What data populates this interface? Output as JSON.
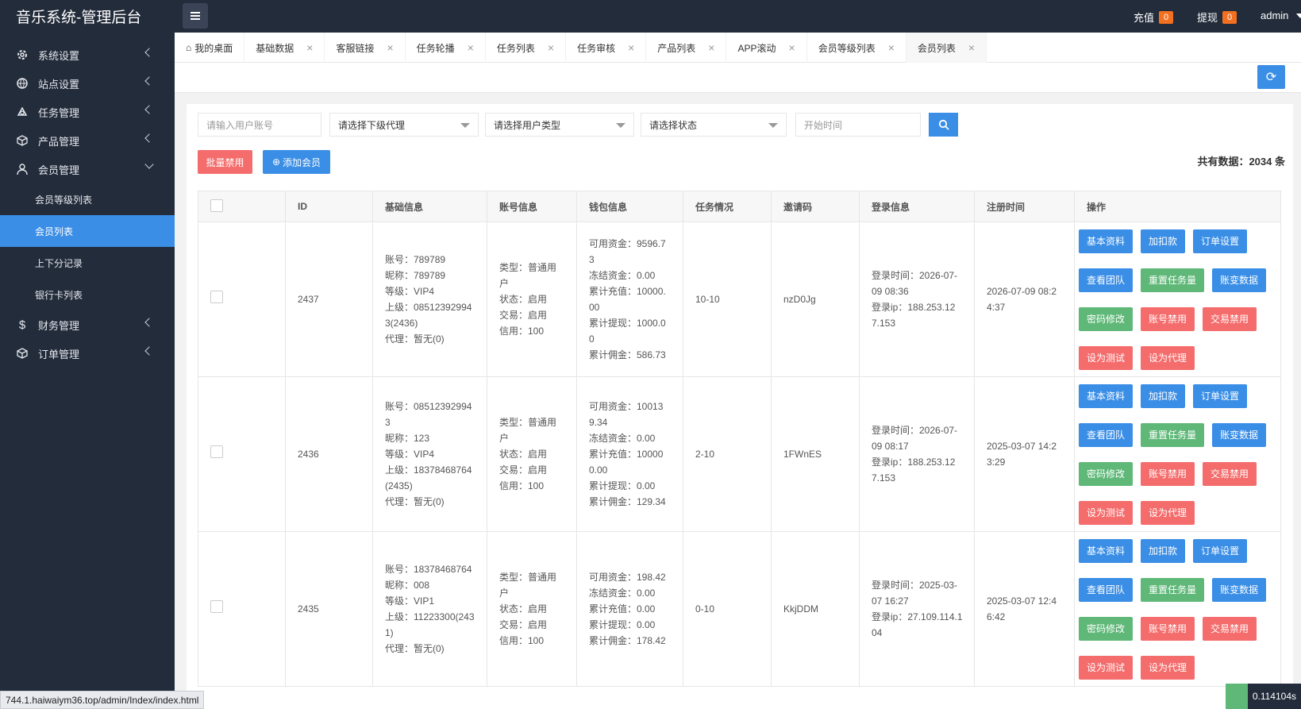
{
  "header": {
    "title": "音乐系统-管理后台",
    "recharge_label": "充值",
    "recharge_count": "0",
    "withdraw_label": "提现",
    "withdraw_count": "0",
    "user": "admin"
  },
  "sidebar": {
    "items": [
      {
        "label": "系统设置",
        "icon": "gear-icon"
      },
      {
        "label": "站点设置",
        "icon": "globe-icon"
      },
      {
        "label": "任务管理",
        "icon": "task-icon"
      },
      {
        "label": "产品管理",
        "icon": "cube-icon"
      },
      {
        "label": "会员管理",
        "icon": "user-icon"
      }
    ],
    "subitems": [
      "会员等级列表",
      "会员列表",
      "上下分记录",
      "银行卡列表"
    ],
    "items2": [
      {
        "label": "财务管理",
        "icon": "dollar-icon"
      },
      {
        "label": "订单管理",
        "icon": "cube-icon"
      }
    ]
  },
  "tabs": [
    "我的桌面",
    "基础数据",
    "客服链接",
    "任务轮播",
    "任务列表",
    "任务审核",
    "产品列表",
    "APP滚动",
    "会员等级列表",
    "会员列表"
  ],
  "filters": {
    "account_placeholder": "请输入用户账号",
    "agent_select": "请选择下级代理",
    "type_select": "请选择用户类型",
    "status_select": "请选择状态",
    "start_placeholder": "开始时间"
  },
  "actions": {
    "batch_ban": "批量禁用",
    "add_member": "添加会员",
    "total": "共有数据：2034 条"
  },
  "table": {
    "headers": [
      "ID",
      "基础信息",
      "账号信息",
      "钱包信息",
      "任务情况",
      "邀请码",
      "登录信息",
      "注册时间",
      "操作"
    ],
    "op_buttons": [
      "基本资料",
      "加扣款",
      "订单设置",
      "查看团队",
      "重置任务量",
      "账变数据",
      "密码修改",
      "账号禁用",
      "交易禁用",
      "设为测试",
      "设为代理"
    ],
    "rows": [
      {
        "id": "2437",
        "basic": [
          "账号：789789",
          "昵称：789789",
          "等级：VIP4",
          "上级：08512392994",
          "3(2436)",
          "代理：暂无(0)"
        ],
        "account": [
          "类型：普通用",
          "户",
          "状态：启用",
          "交易：启用",
          "信用：100"
        ],
        "wallet": [
          "可用资金：9596.7",
          "3",
          "冻结资金：0.00",
          "累计充值：10000.",
          "00",
          "累计提现：1000.0",
          "0",
          "累计佣金：586.73"
        ],
        "task": "10-10",
        "invite": "nzD0Jg",
        "login": [
          "登录时间：2026-07-",
          "09 08:36",
          "登录ip：188.253.12",
          "7.153"
        ],
        "reg": [
          "2026-07-09 08:2",
          "4:37"
        ]
      },
      {
        "id": "2436",
        "basic": [
          "账号：08512392994",
          "3",
          "昵称：123",
          "等级：VIP4",
          "上级：18378468764",
          "(2435)",
          "代理：暂无(0)"
        ],
        "account": [
          "类型：普通用",
          "户",
          "状态：启用",
          "交易：启用",
          "信用：100"
        ],
        "wallet": [
          "可用资金：10013",
          "9.34",
          "冻结资金：0.00",
          "累计充值：10000",
          "0.00",
          "累计提现：0.00",
          "累计佣金：129.34"
        ],
        "task": "2-10",
        "invite": "1FWnES",
        "login": [
          "登录时间：2026-07-",
          "09 08:17",
          "登录ip：188.253.12",
          "7.153"
        ],
        "reg": [
          "2025-03-07 14:2",
          "3:29"
        ]
      },
      {
        "id": "2435",
        "basic": [
          "账号：18378468764",
          "昵称：008",
          "等级：VIP1",
          "上级：11223300(243",
          "1)",
          "代理：暂无(0)"
        ],
        "account": [
          "类型：普通用",
          "户",
          "状态：启用",
          "交易：启用",
          "信用：100"
        ],
        "wallet": [
          "可用资金：198.42",
          "冻结资金：0.00",
          "累计充值：0.00",
          "累计提现：0.00",
          "累计佣金：178.42"
        ],
        "task": "0-10",
        "invite": "KkjDDM",
        "login": [
          "登录时间：2025-03-",
          "07 16:27",
          "登录ip：27.109.114.1",
          "04"
        ],
        "reg": [
          "2025-03-07 12:4",
          "6:42"
        ]
      }
    ]
  },
  "statusbar": "744.1.haiwaiym36.top/admin/Index/index.html",
  "corner_value": "0.114104s",
  "colors": {
    "dark": "#232c3b",
    "primary": "#3a8ee6",
    "green": "#5fb878",
    "red": "#f56c6c",
    "badge": "#f37021"
  }
}
